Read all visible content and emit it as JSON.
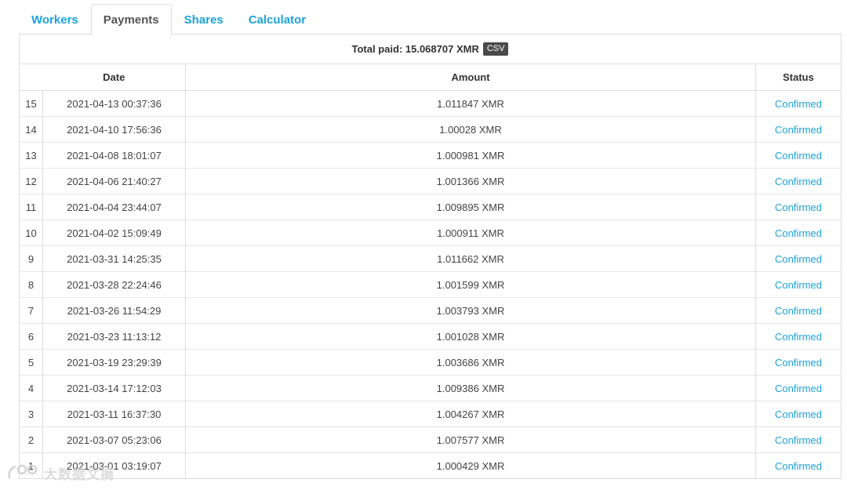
{
  "tabs": [
    {
      "label": "Workers",
      "active": false
    },
    {
      "label": "Payments",
      "active": true
    },
    {
      "label": "Shares",
      "active": false
    },
    {
      "label": "Calculator",
      "active": false
    }
  ],
  "total": {
    "label": "Total paid: 15.068707 XMR",
    "csv_label": "CSV"
  },
  "table": {
    "headers": [
      "",
      "Date",
      "Amount",
      "Status"
    ],
    "rows": [
      {
        "num": "15",
        "date": "2021-04-13 00:37:36",
        "amount": "1.011847 XMR",
        "status": "Confirmed"
      },
      {
        "num": "14",
        "date": "2021-04-10 17:56:36",
        "amount": "1.00028 XMR",
        "status": "Confirmed"
      },
      {
        "num": "13",
        "date": "2021-04-08 18:01:07",
        "amount": "1.000981 XMR",
        "status": "Confirmed"
      },
      {
        "num": "12",
        "date": "2021-04-06 21:40:27",
        "amount": "1.001366 XMR",
        "status": "Confirmed"
      },
      {
        "num": "11",
        "date": "2021-04-04 23:44:07",
        "amount": "1.009895 XMR",
        "status": "Confirmed"
      },
      {
        "num": "10",
        "date": "2021-04-02 15:09:49",
        "amount": "1.000911 XMR",
        "status": "Confirmed"
      },
      {
        "num": "9",
        "date": "2021-03-31 14:25:35",
        "amount": "1.011662 XMR",
        "status": "Confirmed"
      },
      {
        "num": "8",
        "date": "2021-03-28 22:24:46",
        "amount": "1.001599 XMR",
        "status": "Confirmed"
      },
      {
        "num": "7",
        "date": "2021-03-26 11:54:29",
        "amount": "1.003793 XMR",
        "status": "Confirmed"
      },
      {
        "num": "6",
        "date": "2021-03-23 11:13:12",
        "amount": "1.001028 XMR",
        "status": "Confirmed"
      },
      {
        "num": "5",
        "date": "2021-03-19 23:29:39",
        "amount": "1.003686 XMR",
        "status": "Confirmed"
      },
      {
        "num": "4",
        "date": "2021-03-14 17:12:03",
        "amount": "1.009386 XMR",
        "status": "Confirmed"
      },
      {
        "num": "3",
        "date": "2021-03-11 16:37:30",
        "amount": "1.004267 XMR",
        "status": "Confirmed"
      },
      {
        "num": "2",
        "date": "2021-03-07 05:23:06",
        "amount": "1.007577 XMR",
        "status": "Confirmed"
      },
      {
        "num": "1",
        "date": "2021-03-01 03:19:07",
        "amount": "1.000429 XMR",
        "status": "Confirmed"
      }
    ]
  },
  "watermark": {
    "text": "大数据文摘",
    "icon": "watermark-logo-icon"
  },
  "colors": {
    "link": "#1ba3db",
    "csv_bg": "#4a4a4a",
    "border": "#dddddd"
  }
}
